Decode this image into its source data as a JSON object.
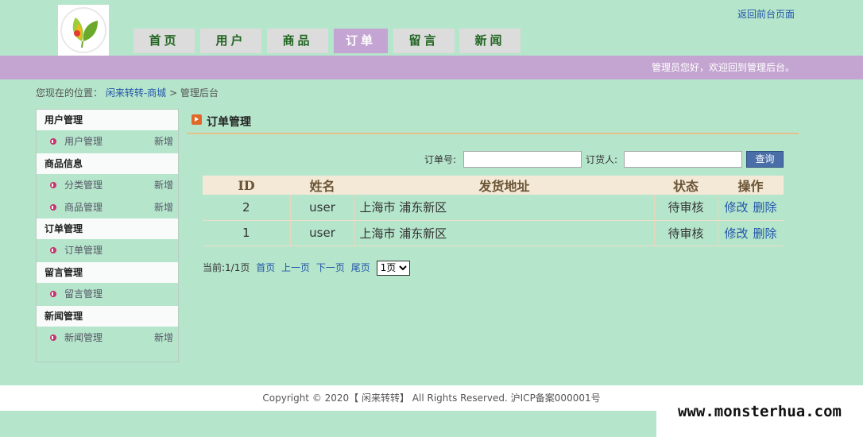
{
  "header": {
    "front_link": "返回前台页面",
    "welcome": "管理员您好，欢迎回到管理后台。",
    "nav": [
      "首页",
      "用户",
      "商品",
      "订单",
      "留言",
      "新闻"
    ],
    "active_nav": "订单",
    "accent_color": "#c4a5d1"
  },
  "breadcrumb": {
    "prefix": "您现在的位置：",
    "site": "闲来转转-商城",
    "sep": ">",
    "current": "管理后台"
  },
  "sidebar": {
    "groups": [
      {
        "title": "用户管理",
        "items": [
          {
            "label": "用户管理",
            "extra": "新增"
          }
        ]
      },
      {
        "title": "商品信息",
        "items": [
          {
            "label": "分类管理",
            "extra": "新增"
          },
          {
            "label": "商品管理",
            "extra": "新增"
          }
        ]
      },
      {
        "title": "订单管理",
        "items": [
          {
            "label": "订单管理",
            "extra": ""
          }
        ]
      },
      {
        "title": "留言管理",
        "items": [
          {
            "label": "留言管理",
            "extra": ""
          }
        ]
      },
      {
        "title": "新闻管理",
        "items": [
          {
            "label": "新闻管理",
            "extra": "新增"
          }
        ]
      }
    ]
  },
  "main": {
    "title": "订单管理",
    "search": {
      "order_no_label": "订单号:",
      "order_no_value": "",
      "buyer_label": "订货人:",
      "buyer_value": "",
      "button": "查询"
    },
    "table": {
      "headers": [
        "ID",
        "姓名",
        "发货地址",
        "状态",
        "操作"
      ],
      "rows": [
        {
          "id": "2",
          "name": "user",
          "address": "上海市 浦东新区",
          "status": "待审核",
          "edit": "修改",
          "delete": "删除"
        },
        {
          "id": "1",
          "name": "user",
          "address": "上海市 浦东新区",
          "status": "待审核",
          "edit": "修改",
          "delete": "删除"
        }
      ]
    },
    "pager": {
      "info": "当前:1/1页",
      "first": "首页",
      "prev": "上一页",
      "next": "下一页",
      "last": "尾页",
      "select_value": "1页"
    }
  },
  "footer": {
    "copyright": "Copyright © 2020【 闲来转转】 All Rights Reserved. 沪ICP备案000001号",
    "watermark": "www.monsterhua.com"
  }
}
